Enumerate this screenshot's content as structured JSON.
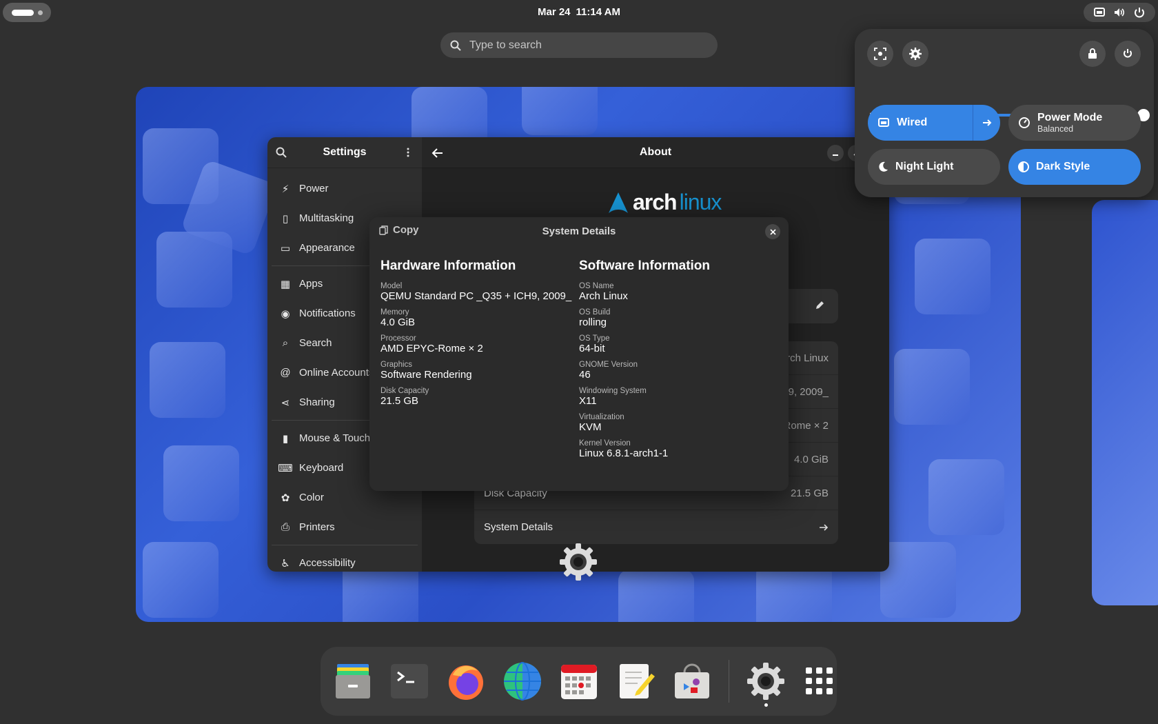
{
  "topbar": {
    "date": "Mar 24",
    "time": "11:14 AM"
  },
  "search": {
    "placeholder": "Type to search"
  },
  "settings": {
    "sidebar_title": "Settings",
    "sidebar_items": [
      {
        "label": "Power",
        "icon": "power-icon"
      },
      {
        "label": "Multitasking",
        "icon": "multitasking-icon"
      },
      {
        "label": "Appearance",
        "icon": "appearance-icon"
      },
      {
        "label": "Apps",
        "icon": "apps-icon"
      },
      {
        "label": "Notifications",
        "icon": "notifications-icon"
      },
      {
        "label": "Search",
        "icon": "search-icon"
      },
      {
        "label": "Online Accounts",
        "icon": "online-accounts-icon"
      },
      {
        "label": "Sharing",
        "icon": "sharing-icon"
      },
      {
        "label": "Mouse & Touchpad",
        "icon": "mouse-icon"
      },
      {
        "label": "Keyboard",
        "icon": "keyboard-icon"
      },
      {
        "label": "Color",
        "icon": "color-icon"
      },
      {
        "label": "Printers",
        "icon": "printer-icon"
      },
      {
        "label": "Accessibility",
        "icon": "accessibility-icon"
      }
    ],
    "page_title": "About",
    "logo_text_1": "arch",
    "logo_text_2": "linux",
    "rows": [
      {
        "label": "Disk Capacity",
        "value": "21.5 GB"
      },
      {
        "label": "System Details",
        "value": ""
      }
    ],
    "partial_values": {
      "os_name": "rch Linux",
      "model": "9, 2009_",
      "processor": "Rome × 2",
      "memory": "4.0 GiB"
    }
  },
  "dialog": {
    "title": "System Details",
    "copy_label": "Copy",
    "hardware": {
      "heading": "Hardware Information",
      "fields": [
        {
          "label": "Model",
          "value": "QEMU Standard PC _Q35 + ICH9, 2009_"
        },
        {
          "label": "Memory",
          "value": "4.0 GiB"
        },
        {
          "label": "Processor",
          "value": "AMD EPYC-Rome × 2"
        },
        {
          "label": "Graphics",
          "value": "Software Rendering"
        },
        {
          "label": "Disk Capacity",
          "value": "21.5 GB"
        }
      ]
    },
    "software": {
      "heading": "Software Information",
      "fields": [
        {
          "label": "OS Name",
          "value": "Arch Linux"
        },
        {
          "label": "OS Build",
          "value": "rolling"
        },
        {
          "label": "OS Type",
          "value": "64-bit"
        },
        {
          "label": "GNOME Version",
          "value": "46"
        },
        {
          "label": "Windowing System",
          "value": "X11"
        },
        {
          "label": "Virtualization",
          "value": "KVM"
        },
        {
          "label": "Kernel Version",
          "value": "Linux 6.8.1-arch1-1"
        }
      ]
    }
  },
  "quick_settings": {
    "volume_level": 1.0,
    "wired_label": "Wired",
    "power_mode_label": "Power Mode",
    "power_mode_value": "Balanced",
    "night_light_label": "Night Light",
    "dark_style_label": "Dark Style",
    "accent_color": "#3584e4"
  },
  "dock": {
    "apps": [
      "files-icon",
      "terminal-icon",
      "firefox-icon",
      "web-browser-icon",
      "calendar-icon",
      "text-editor-icon",
      "software-icon",
      "settings-icon",
      "app-grid-icon"
    ]
  }
}
